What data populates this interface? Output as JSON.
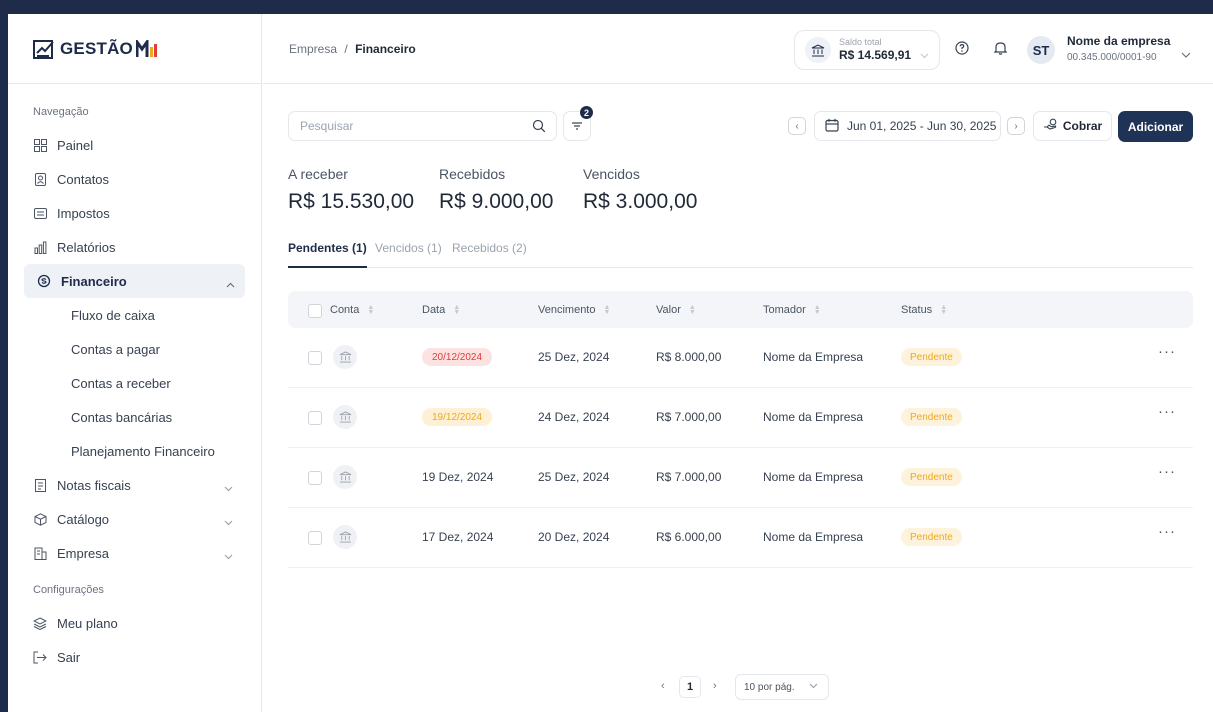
{
  "logo": {
    "text": "GESTÃO"
  },
  "sidebar": {
    "nav_section": "Navegação",
    "items": [
      {
        "label": "Painel",
        "icon": "grid-icon"
      },
      {
        "label": "Contatos",
        "icon": "contact-icon"
      },
      {
        "label": "Impostos",
        "icon": "tax-icon"
      },
      {
        "label": "Relatórios",
        "icon": "chart-icon"
      },
      {
        "label": "Financeiro",
        "icon": "finance-icon"
      },
      {
        "label": "Notas fiscais",
        "icon": "invoice-icon"
      },
      {
        "label": "Catálogo",
        "icon": "box-icon"
      },
      {
        "label": "Empresa",
        "icon": "building-icon"
      }
    ],
    "financeiro_sub": [
      {
        "label": "Fluxo de caixa"
      },
      {
        "label": "Contas a pagar"
      },
      {
        "label": "Contas a receber"
      },
      {
        "label": "Contas bancárias"
      },
      {
        "label": "Planejamento Financeiro"
      }
    ],
    "config_section": "Configurações",
    "config_items": [
      {
        "label": "Meu plano",
        "icon": "layers-icon"
      },
      {
        "label": "Sair",
        "icon": "logout-icon"
      }
    ]
  },
  "header": {
    "breadcrumb_parent": "Empresa",
    "breadcrumb_sep": "/",
    "breadcrumb_current": "Financeiro",
    "balance_label": "Saldo total",
    "balance_value": "R$ 14.569,91",
    "avatar_initials": "ST",
    "company_name": "Nome da empresa",
    "company_cnpj": "00.345.000/0001-90"
  },
  "toolbar": {
    "search_placeholder": "Pesquisar",
    "filter_count": "2",
    "date_range": "Jun 01, 2025 - Jun 30, 2025",
    "cobrar_label": "Cobrar",
    "adicionar_label": "Adicionar"
  },
  "summary": [
    {
      "label": "A receber",
      "value": "R$ 15.530,00"
    },
    {
      "label": "Recebidos",
      "value": "R$ 9.000,00"
    },
    {
      "label": "Vencidos",
      "value": "R$ 3.000,00"
    }
  ],
  "tabs": [
    {
      "label": "Pendentes (1)"
    },
    {
      "label": "Vencidos (1)"
    },
    {
      "label": "Recebidos (2)"
    }
  ],
  "table": {
    "columns": [
      "Conta",
      "Data",
      "Vencimento",
      "Valor",
      "Tomador",
      "Status"
    ],
    "rows": [
      {
        "data": "20/12/2024",
        "data_style": "overdue",
        "vencimento": "25 Dez, 2024",
        "valor": "R$ 8.000,00",
        "tomador": "Nome da Empresa",
        "status": "Pendente"
      },
      {
        "data": "19/12/2024",
        "data_style": "due-soon",
        "vencimento": "24 Dez, 2024",
        "valor": "R$ 7.000,00",
        "tomador": "Nome da Empresa",
        "status": "Pendente"
      },
      {
        "data": "19 Dez, 2024",
        "data_style": "plain",
        "vencimento": "25 Dez, 2024",
        "valor": "R$ 7.000,00",
        "tomador": "Nome da Empresa",
        "status": "Pendente"
      },
      {
        "data": "17 Dez, 2024",
        "data_style": "plain",
        "vencimento": "20 Dez, 2024",
        "valor": "R$ 6.000,00",
        "tomador": "Nome da Empresa",
        "status": "Pendente"
      }
    ],
    "more_label": "···"
  },
  "pagination": {
    "current_page": "1",
    "per_page": "10 por pág."
  },
  "colors": {
    "brand": "#1e2c4a",
    "overdue_bg": "#fde2e2",
    "overdue_text": "#e23b3b",
    "due_bg": "#fdf0d5",
    "due_text": "#f0a81d"
  }
}
